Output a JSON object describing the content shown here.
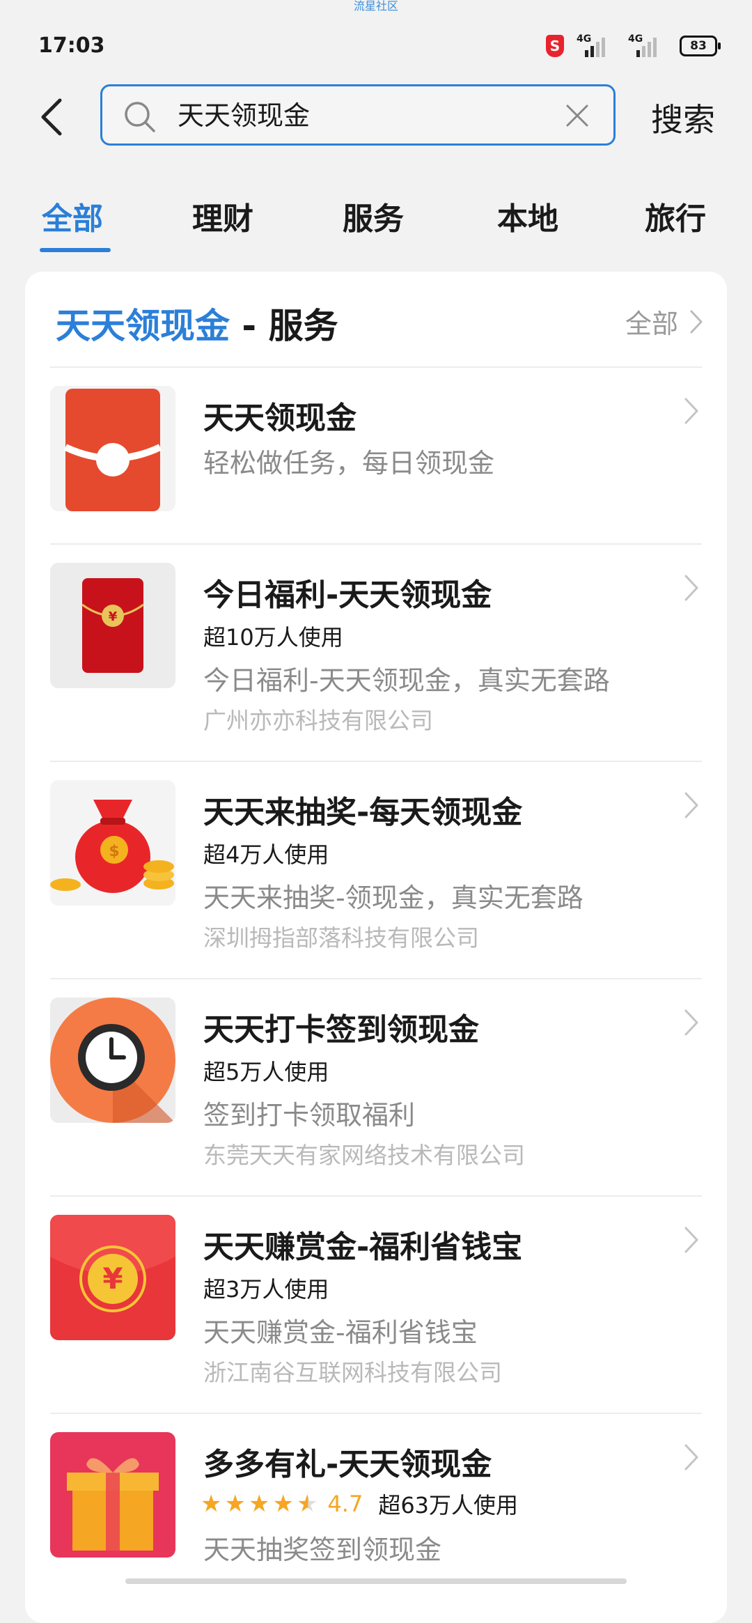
{
  "watermark": "流星社区",
  "status_bar": {
    "time": "17:03",
    "shield_badge": "S",
    "signal1_label": "4G",
    "signal2_label": "4G",
    "battery": "83"
  },
  "search": {
    "query": "天天领现金",
    "submit_label": "搜索"
  },
  "tabs": [
    {
      "label": "全部",
      "active": true
    },
    {
      "label": "理财"
    },
    {
      "label": "服务"
    },
    {
      "label": "本地"
    },
    {
      "label": "旅行"
    }
  ],
  "card": {
    "title_keyword": "天天领现金",
    "title_suffix": " - 服务",
    "all_label": "全部"
  },
  "results": [
    {
      "title": "天天领现金",
      "users": "",
      "desc": "轻松做任务，每日领现金",
      "company": "",
      "icon": "red-envelope-icon"
    },
    {
      "title": "今日福利-天天领现金",
      "users": "超10万人使用",
      "desc": "今日福利-天天领现金，真实无套路",
      "company": "广州亦亦科技有限公司",
      "icon": "red-packet-yen-icon"
    },
    {
      "title": "天天来抽奖-每天领现金",
      "users": "超4万人使用",
      "desc": "天天来抽奖-领现金，真实无套路",
      "company": "深圳拇指部落科技有限公司",
      "icon": "money-bag-icon"
    },
    {
      "title": "天天打卡签到领现金",
      "users": "超5万人使用",
      "desc": "签到打卡领取福利",
      "company": "东莞天天有家网络技术有限公司",
      "icon": "clock-icon"
    },
    {
      "title": "天天赚赏金-福利省钱宝",
      "users": "超3万人使用",
      "desc": "天天赚赏金-福利省钱宝",
      "company": "浙江南谷互联网科技有限公司",
      "icon": "yen-coin-icon"
    },
    {
      "title": "多多有礼-天天领现金",
      "rating": "4.7",
      "rating_fraction": 0.94,
      "users": "超63万人使用",
      "desc": "天天抽奖签到领现金",
      "company": "",
      "icon": "gift-box-icon"
    }
  ],
  "colors": {
    "accent": "#2b7fd8",
    "star": "#f5a623",
    "background": "#f2f2f2"
  }
}
